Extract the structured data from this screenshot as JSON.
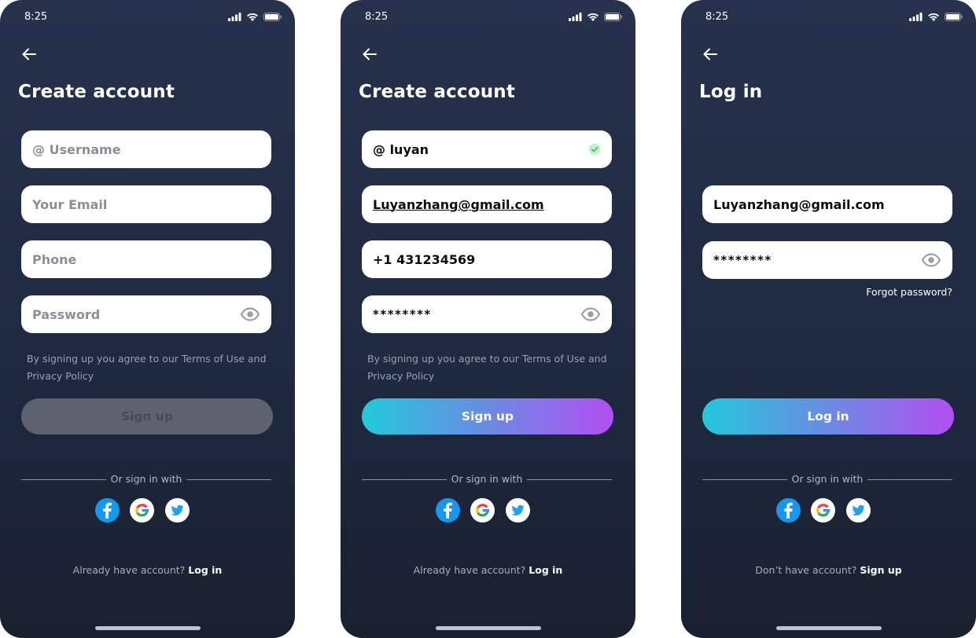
{
  "colors": {
    "background": "#1f2a40",
    "field_bg": "#ffffff",
    "gradient_start": "#22c9db",
    "gradient_end": "#b14ff0",
    "disabled_button": "#5e6270",
    "facebook": "#1597ee",
    "twitter": "#1da1f2",
    "valid_check": "#3ec45e"
  },
  "screens": [
    {
      "status_time": "8:25",
      "title": "Create account",
      "fields": [
        {
          "kind": "username",
          "value": "",
          "placeholder": "@ Username",
          "trailing_icon": ""
        },
        {
          "kind": "email",
          "value": "",
          "placeholder": "Your Email",
          "trailing_icon": ""
        },
        {
          "kind": "phone",
          "value": "",
          "placeholder": "Phone",
          "trailing_icon": ""
        },
        {
          "kind": "password",
          "value": "",
          "placeholder": "Password",
          "trailing_icon": "eye-icon"
        }
      ],
      "terms": "By signing up you agree to our Terms of Use and Privacy Policy",
      "primary_button": {
        "label": "Sign up",
        "state": "disabled"
      },
      "divider_label": "Or sign in with",
      "social": [
        "facebook-icon",
        "google-icon",
        "twitter-icon"
      ],
      "footer": {
        "text": "Already have account?",
        "link": "Log in"
      }
    },
    {
      "status_time": "8:25",
      "title": "Create account",
      "fields": [
        {
          "kind": "username",
          "value": "@ luyan",
          "placeholder": "@ Username",
          "trailing_icon": "check-circle-icon"
        },
        {
          "kind": "email",
          "value": "Luyanzhang@gmail.com",
          "placeholder": "Your Email",
          "trailing_icon": ""
        },
        {
          "kind": "phone",
          "value": "+1 431234569",
          "placeholder": "Phone",
          "trailing_icon": ""
        },
        {
          "kind": "password",
          "value": "********",
          "placeholder": "Password",
          "trailing_icon": "eye-icon"
        }
      ],
      "terms": "By signing up you agree to our Terms of Use and Privacy Policy",
      "primary_button": {
        "label": "Sign up",
        "state": "enabled"
      },
      "divider_label": "Or sign in with",
      "social": [
        "facebook-icon",
        "google-icon",
        "twitter-icon"
      ],
      "footer": {
        "text": "Already have account?",
        "link": "Log in"
      }
    },
    {
      "status_time": "8:25",
      "title": "Log in",
      "fields": [
        {
          "kind": "email",
          "value": "Luyanzhang@gmail.com",
          "placeholder": "Your Email",
          "trailing_icon": ""
        },
        {
          "kind": "password",
          "value": "********",
          "placeholder": "Password",
          "trailing_icon": "eye-icon"
        }
      ],
      "forgot_password": "Forgot password?",
      "primary_button": {
        "label": "Log in",
        "state": "enabled"
      },
      "divider_label": "Or sign in with",
      "social": [
        "facebook-icon",
        "google-icon",
        "twitter-icon"
      ],
      "footer": {
        "text": "Don’t have account?",
        "link": "Sign up"
      }
    }
  ]
}
